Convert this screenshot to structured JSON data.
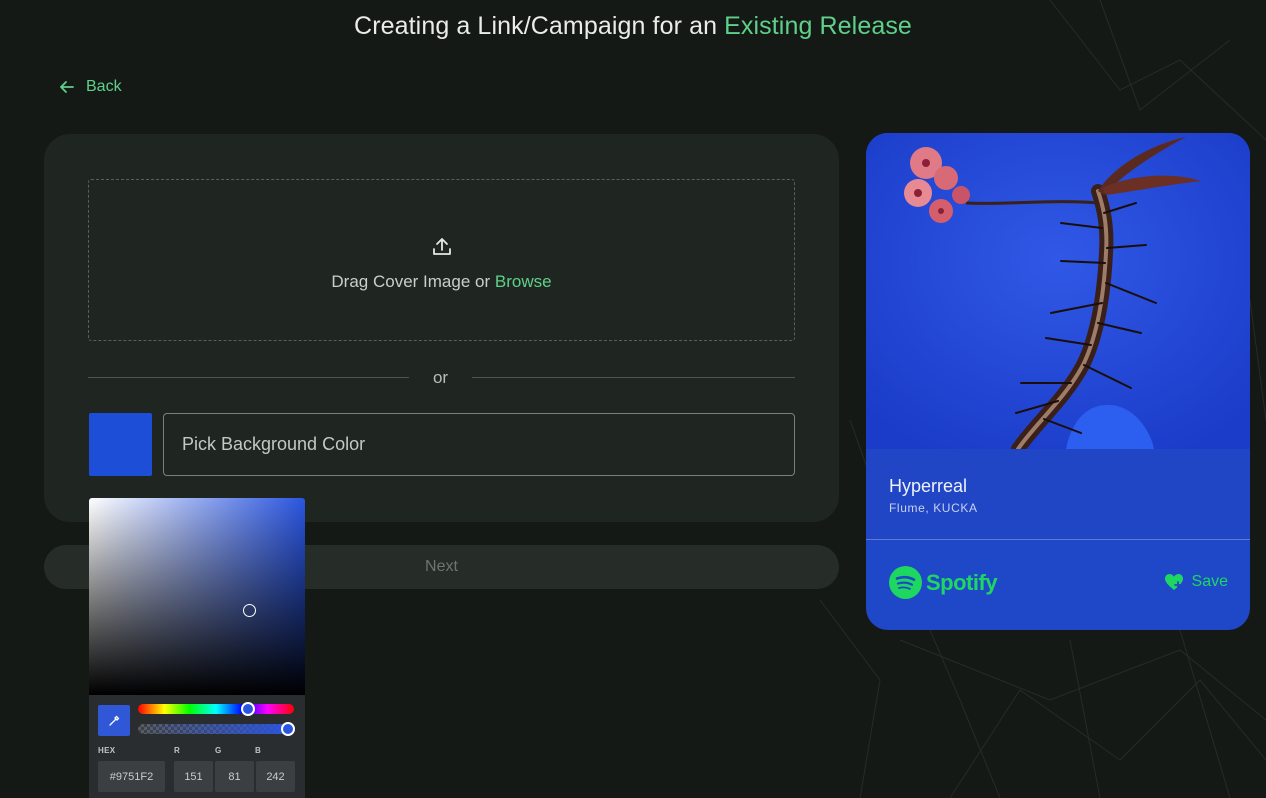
{
  "header": {
    "title_prefix": "Creating a Link/Campaign for an",
    "title_accent": "Existing Release"
  },
  "nav": {
    "back_label": "Back"
  },
  "upload": {
    "text": "Drag Cover Image",
    "or_label": "or",
    "browse_label": "Browse"
  },
  "divider": {
    "label": "or"
  },
  "background": {
    "placeholder": "Pick Background Color",
    "swatch_color": "#1d4ed8"
  },
  "next_button": {
    "label": "Next"
  },
  "color_picker": {
    "labels": {
      "hex": "HEX",
      "r": "R",
      "g": "G",
      "b": "B"
    },
    "values": {
      "hex": "#9751F2",
      "r": "151",
      "g": "81",
      "b": "242"
    }
  },
  "preview": {
    "title": "Hyperreal",
    "artist": "Flume, KUCKA",
    "brand": "Spotify",
    "save_label": "Save",
    "accent_color": "#1ed760",
    "card_color": "#1f48c8"
  }
}
